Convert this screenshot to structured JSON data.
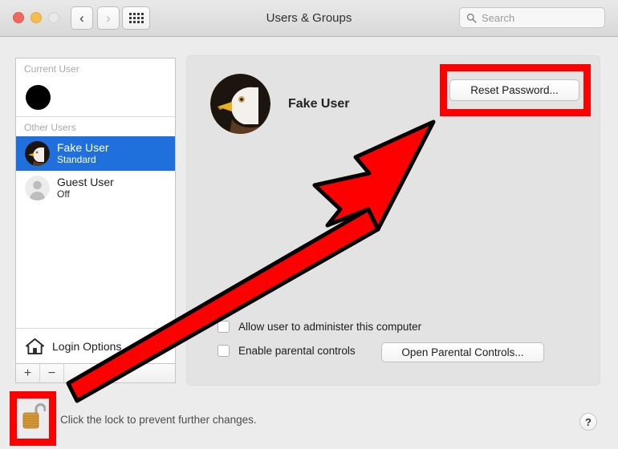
{
  "window": {
    "title": "Users & Groups",
    "traffic_lights": [
      "close-red",
      "minimize-yellow",
      "zoom-disabled"
    ],
    "back_icon": "‹",
    "forward_icon": "›",
    "grid_icon": "grid-button"
  },
  "search": {
    "placeholder": "Search",
    "icon": "search-icon",
    "value": ""
  },
  "sidebar": {
    "current_user_header": "Current User",
    "other_users_header": "Other Users",
    "current_user": {
      "avatar": "black-circle-avatar"
    },
    "users": [
      {
        "name": "Fake User",
        "role": "Standard",
        "selected": true,
        "avatar": "eagle-avatar"
      },
      {
        "name": "Guest User",
        "role": "Off",
        "selected": false,
        "avatar": "person-silhouette-avatar"
      }
    ],
    "login_options": {
      "label": "Login Options",
      "icon": "home-icon"
    },
    "add_button": "+",
    "remove_button": "−"
  },
  "main": {
    "account_name": "Fake User",
    "account_avatar": "eagle-avatar",
    "reset_password_label": "Reset Password...",
    "checkboxes": [
      {
        "label": "Allow user to administer this computer",
        "checked": false
      },
      {
        "label": "Enable parental controls",
        "checked": false
      }
    ],
    "parental_controls_label": "Open Parental Controls..."
  },
  "footer": {
    "lock_icon": "unlocked-padlock-icon",
    "lock_text": "Click the lock to prevent further changes.",
    "help_label": "?"
  },
  "annotations": {
    "color": "#fe0000",
    "highlight_reset_password": true,
    "highlight_lock": true,
    "arrow": {
      "from": "lock-icon",
      "to": "reset-password-button"
    }
  },
  "colors": {
    "selection_blue": "#1f6fdd",
    "window_bg": "#ececec",
    "panel_bg": "#e3e3e3",
    "annotation_red": "#fe0000"
  }
}
